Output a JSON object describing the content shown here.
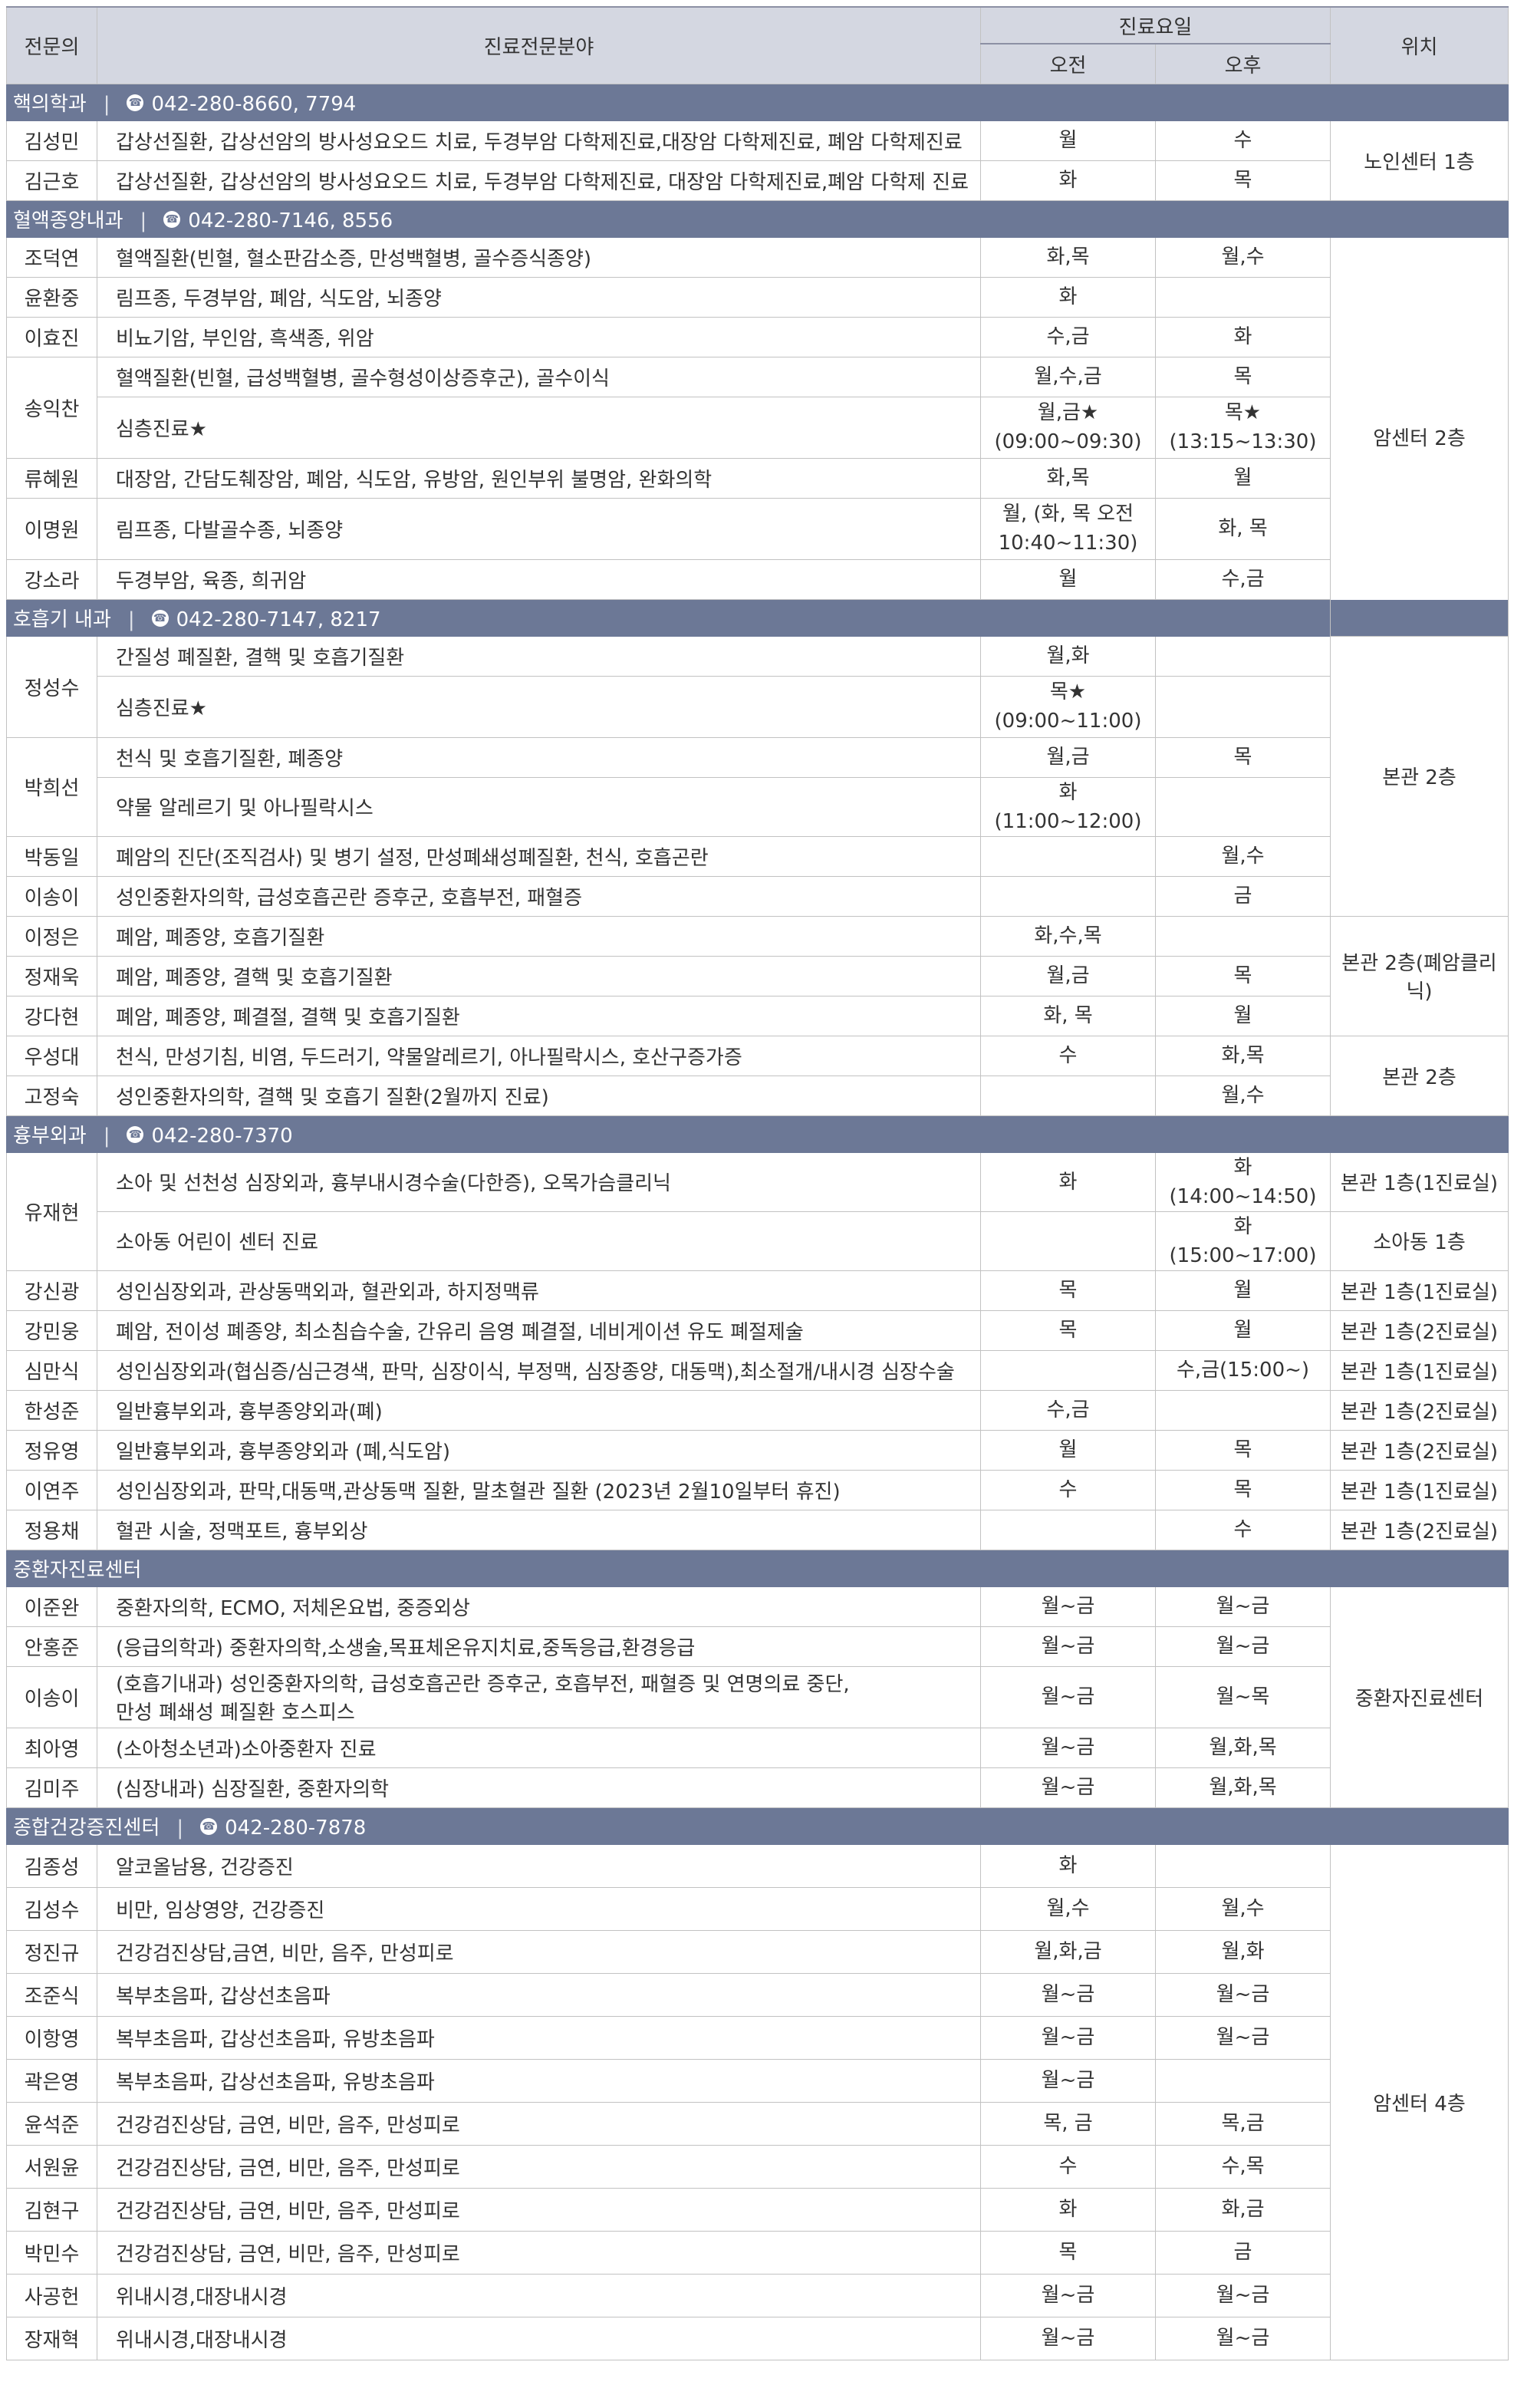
{
  "header": {
    "col_dept": "전문의",
    "col_field": "진료전문분야",
    "col_days": "진료요일",
    "col_am": "오전",
    "col_pm": "오후",
    "col_loc": "위치"
  },
  "sections": [
    {
      "title": "핵의학과",
      "phone": "042-280-8660, 7794",
      "rows": [
        {
          "name": "김성민",
          "field": [
            "갑상선질환, 갑상선암의 방사성요오드 치료, 두경부암 다학제진료,대장암 다학제진료, 폐암 다학제진료"
          ],
          "am": [
            "월"
          ],
          "pm": [
            "수"
          ],
          "loc": "노인센터 1층",
          "loc_span": 2
        },
        {
          "name": "김근호",
          "field": [
            "갑상선질환, 갑상선암의 방사성요오드 치료, 두경부암 다학제진료, 대장암 다학제진료,폐암 다학제 진료"
          ],
          "am": [
            "화"
          ],
          "pm": [
            "목"
          ]
        }
      ]
    },
    {
      "title": "혈액종양내과",
      "phone": "042-280-7146, 8556",
      "rows": [
        {
          "name": "조덕연",
          "field": [
            "혈액질환(빈혈, 혈소판감소증, 만성백혈병, 골수증식종양)"
          ],
          "am": [
            "화,목"
          ],
          "pm": [
            "월,수"
          ],
          "loc": "암센터 2층",
          "loc_span": 9
        },
        {
          "name": "윤환중",
          "field": [
            "림프종, 두경부암, 폐암, 식도암, 뇌종양"
          ],
          "am": [
            "화"
          ],
          "pm": []
        },
        {
          "name": "이효진",
          "field": [
            "비뇨기암, 부인암, 흑색종, 위암"
          ],
          "am": [
            "수,금"
          ],
          "pm": [
            "화"
          ]
        },
        {
          "name": "송익찬",
          "name_span": 2,
          "field": [
            "혈액질환(빈혈, 급성백혈병, 골수형성이상증후군), 골수이식"
          ],
          "am": [
            "월,수,금"
          ],
          "pm": [
            "목"
          ]
        },
        {
          "field": [
            "심층진료★"
          ],
          "am": [
            "월,금★",
            "(09:00~09:30)"
          ],
          "pm": [
            "목★",
            "(13:15~13:30)"
          ],
          "tall": true
        },
        {
          "name": "류혜원",
          "field": [
            "대장암, 간담도췌장암, 폐암, 식도암, 유방암, 원인부위 불명암, 완화의학"
          ],
          "am": [
            "화,목"
          ],
          "pm": [
            "월"
          ]
        },
        {
          "name": "이명원",
          "field": [
            "림프종, 다발골수종, 뇌종양"
          ],
          "am": [
            "월, (화, 목 오전",
            "10:40~11:30)"
          ],
          "pm": [
            "화, 목"
          ],
          "tall": true
        },
        {
          "name": "강소라",
          "field": [
            "두경부암, 육종, 희귀암"
          ],
          "am": [
            "월"
          ],
          "pm": [
            "수,금"
          ]
        }
      ]
    },
    {
      "title": "호흡기 내과",
      "phone": "042-280-7147, 8217",
      "rows": [
        {
          "name": "정성수",
          "name_span": 2,
          "field": [
            "간질성 폐질환, 결핵 및 호흡기질환"
          ],
          "am": [
            "월,화"
          ],
          "pm": [],
          "loc": "본관 2층",
          "loc_span": 6
        },
        {
          "field": [
            "심층진료★"
          ],
          "am": [
            "목★",
            "(09:00~11:00)"
          ],
          "pm": [],
          "tall": true
        },
        {
          "name": "박희선",
          "name_span": 2,
          "field": [
            "천식 및 호흡기질환, 폐종양"
          ],
          "am": [
            "월,금"
          ],
          "pm": [
            "목"
          ]
        },
        {
          "field": [
            "약물 알레르기 및 아나필락시스"
          ],
          "am": [
            "화(11:00~12:00)"
          ],
          "pm": []
        },
        {
          "name": "박동일",
          "field": [
            "폐암의 진단(조직검사) 및 병기 설정, 만성폐쇄성폐질환, 천식, 호흡곤란"
          ],
          "am": [],
          "pm": [
            "월,수"
          ]
        },
        {
          "name": "이송이",
          "field": [
            "성인중환자의학, 급성호흡곤란 증후군, 호흡부전, 패혈증"
          ],
          "am": [],
          "pm": [
            "금"
          ]
        },
        {
          "name": "이정은",
          "field": [
            "폐암, 폐종양, 호흡기질환"
          ],
          "am": [
            "화,수,목"
          ],
          "pm": [],
          "loc": "본관 2층(폐암클리닉)",
          "loc_span": 3
        },
        {
          "name": "정재욱",
          "field": [
            "폐암, 폐종양, 결핵 및 호흡기질환"
          ],
          "am": [
            "월,금"
          ],
          "pm": [
            "목"
          ]
        },
        {
          "name": "강다현",
          "field": [
            "폐암, 폐종양, 폐결절, 결핵 및 호흡기질환"
          ],
          "am": [
            "화, 목"
          ],
          "pm": [
            "월"
          ]
        },
        {
          "name": "우성대",
          "field": [
            "천식, 만성기침, 비염, 두드러기, 약물알레르기, 아나필락시스, 호산구증가증"
          ],
          "am": [
            "수"
          ],
          "pm": [
            "화,목"
          ],
          "loc": "본관 2층",
          "loc_span": 2
        },
        {
          "name": "고정숙",
          "field": [
            "성인중환자의학, 결핵 및 호흡기 질환(2월까지 진료)"
          ],
          "am": [],
          "pm": [
            "월,수"
          ]
        }
      ]
    },
    {
      "title": "흉부외과",
      "phone": "042-280-7370",
      "rows": [
        {
          "name": "유재현",
          "name_span": 2,
          "field": [
            "소아 및 선천성 심장외과, 흉부내시경수술(다한증), 오목가슴클리닉"
          ],
          "am": [
            "화"
          ],
          "pm": [
            "화(14:00~14:50)"
          ],
          "loc": "본관 1층(1진료실)",
          "loc_span": 1
        },
        {
          "field": [
            "소아동 어린이 센터 진료"
          ],
          "am": [],
          "pm": [
            "화(15:00~17:00)"
          ],
          "loc": "소아동 1층",
          "loc_span": 1
        },
        {
          "name": "강신광",
          "field": [
            "성인심장외과, 관상동맥외과, 혈관외과, 하지정맥류"
          ],
          "am": [
            "목"
          ],
          "pm": [
            "월"
          ],
          "loc": "본관 1층(1진료실)",
          "loc_span": 1
        },
        {
          "name": "강민웅",
          "field": [
            "폐암, 전이성 폐종양, 최소침습수술, 간유리 음영 폐결절, 네비게이션 유도 폐절제술"
          ],
          "am": [
            "목"
          ],
          "pm": [
            "월"
          ],
          "loc": "본관 1층(2진료실)",
          "loc_span": 1
        },
        {
          "name": "심만식",
          "field": [
            "성인심장외과(협심증/심근경색, 판막, 심장이식, 부정맥, 심장종양, 대동맥),최소절개/내시경 심장수술"
          ],
          "am": [],
          "pm": [
            "수,금(15:00~)"
          ],
          "loc": "본관 1층(1진료실)",
          "loc_span": 1
        },
        {
          "name": "한성준",
          "field": [
            "일반흉부외과, 흉부종양외과(폐)"
          ],
          "am": [
            "수,금"
          ],
          "pm": [],
          "loc": "본관 1층(2진료실)",
          "loc_span": 1
        },
        {
          "name": "정유영",
          "field": [
            "일반흉부외과, 흉부종양외과 (폐,식도암)"
          ],
          "am": [
            "월"
          ],
          "pm": [
            "목"
          ],
          "loc": "본관 1층(2진료실)",
          "loc_span": 1
        },
        {
          "name": "이연주",
          "field": [
            "성인심장외과, 판막,대동맥,관상동맥 질환, 말초혈관 질환 (2023년 2월10일부터 휴진)"
          ],
          "am": [
            "수"
          ],
          "pm": [
            "목"
          ],
          "loc": "본관 1층(1진료실)",
          "loc_span": 1
        },
        {
          "name": "정용채",
          "field": [
            "혈관 시술, 정맥포트, 흉부외상"
          ],
          "am": [],
          "pm": [
            "수"
          ],
          "loc": "본관 1층(2진료실)",
          "loc_span": 1
        }
      ]
    },
    {
      "title": "중환자진료센터",
      "phone": "",
      "rows": [
        {
          "name": "이준완",
          "field": [
            "중환자의학, ECMO, 저체온요법, 중증외상"
          ],
          "am": [
            "월~금"
          ],
          "pm": [
            "월~금"
          ],
          "loc": "중환자진료센터",
          "loc_span": 5
        },
        {
          "name": "안홍준",
          "field": [
            "(응급의학과) 중환자의학,소생술,목표체온유지치료,중독응급,환경응급"
          ],
          "am": [
            "월~금"
          ],
          "pm": [
            "월~금"
          ]
        },
        {
          "name": "이송이",
          "field": [
            "(호흡기내과) 성인중환자의학, 급성호흡곤란 증후군, 호흡부전, 패혈증 및 연명의료 중단,",
            "만성 폐쇄성 폐질환 호스피스"
          ],
          "am": [
            "월~금"
          ],
          "pm": [
            "월~목"
          ],
          "tall": true
        },
        {
          "name": "최아영",
          "field": [
            "(소아청소년과)소아중환자 진료"
          ],
          "am": [
            "월~금"
          ],
          "pm": [
            "월,화,목"
          ]
        },
        {
          "name": "김미주",
          "field": [
            "(심장내과) 심장질환, 중환자의학"
          ],
          "am": [
            "월~금"
          ],
          "pm": [
            "월,화,목"
          ]
        }
      ]
    },
    {
      "title": "종합건강증진센터",
      "phone": "042-280-7878",
      "rows": [
        {
          "name": "김종성",
          "field": [
            "알코올남용, 건강증진"
          ],
          "am": [
            "화"
          ],
          "pm": [],
          "loc": "암센터 4층",
          "loc_span": 12,
          "h": 56
        },
        {
          "name": "김성수",
          "field": [
            "비만, 임상영양, 건강증진"
          ],
          "am": [
            "월,수"
          ],
          "pm": [
            "월,수"
          ],
          "h": 56
        },
        {
          "name": "정진규",
          "field": [
            "건강검진상담,금연, 비만, 음주, 만성피로"
          ],
          "am": [
            "월,화,금"
          ],
          "pm": [
            "월,화"
          ],
          "h": 56
        },
        {
          "name": "조준식",
          "field": [
            "복부초음파, 갑상선초음파"
          ],
          "am": [
            "월~금"
          ],
          "pm": [
            "월~금"
          ],
          "h": 56
        },
        {
          "name": "이항영",
          "field": [
            "복부초음파, 갑상선초음파, 유방초음파"
          ],
          "am": [
            "월~금"
          ],
          "pm": [
            "월~금"
          ],
          "h": 56
        },
        {
          "name": "곽은영",
          "field": [
            "복부초음파, 갑상선초음파, 유방초음파"
          ],
          "am": [
            "월~금"
          ],
          "pm": [],
          "h": 56
        },
        {
          "name": "윤석준",
          "field": [
            "건강검진상담, 금연, 비만, 음주, 만성피로"
          ],
          "am": [
            "목, 금"
          ],
          "pm": [
            "목,금"
          ],
          "h": 56
        },
        {
          "name": "서원윤",
          "field": [
            "건강검진상담, 금연, 비만, 음주, 만성피로"
          ],
          "am": [
            "수"
          ],
          "pm": [
            "수,목"
          ],
          "h": 56
        },
        {
          "name": "김현구",
          "field": [
            "건강검진상담, 금연, 비만, 음주, 만성피로"
          ],
          "am": [
            "화"
          ],
          "pm": [
            "화,금"
          ],
          "h": 56
        },
        {
          "name": "박민수",
          "field": [
            "건강검진상담, 금연, 비만, 음주, 만성피로"
          ],
          "am": [
            "목"
          ],
          "pm": [
            "금"
          ],
          "h": 56
        },
        {
          "name": "사공헌",
          "field": [
            "위내시경,대장내시경"
          ],
          "am": [
            "월~금"
          ],
          "pm": [
            "월~금"
          ],
          "h": 56
        },
        {
          "name": "장재혁",
          "field": [
            "위내시경,대장내시경"
          ],
          "am": [
            "월~금"
          ],
          "pm": [
            "월~금"
          ],
          "h": 56
        }
      ]
    }
  ]
}
